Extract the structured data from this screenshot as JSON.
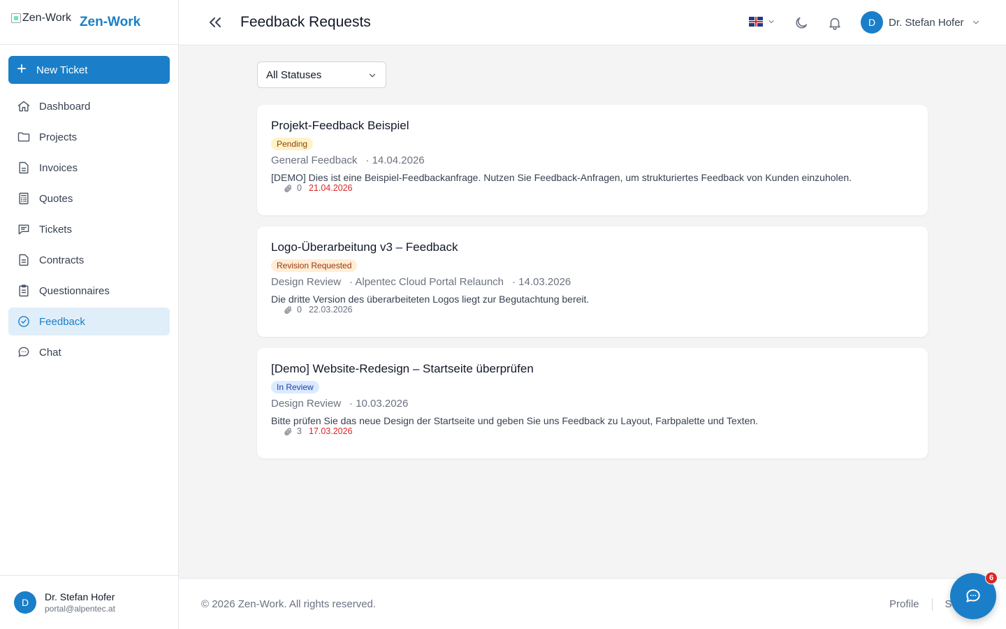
{
  "brand": {
    "logo_alt": "Zen-Work",
    "name": "Zen-Work"
  },
  "sidebar": {
    "new_ticket_label": "New Ticket",
    "items": [
      {
        "label": "Dashboard",
        "icon": "home-icon"
      },
      {
        "label": "Projects",
        "icon": "folder-icon"
      },
      {
        "label": "Invoices",
        "icon": "document-icon"
      },
      {
        "label": "Quotes",
        "icon": "calculator-icon"
      },
      {
        "label": "Tickets",
        "icon": "message-square-icon"
      },
      {
        "label": "Contracts",
        "icon": "document-text-icon"
      },
      {
        "label": "Questionnaires",
        "icon": "clipboard-icon"
      },
      {
        "label": "Feedback",
        "icon": "check-circle-icon",
        "active": true
      },
      {
        "label": "Chat",
        "icon": "chat-bubble-icon"
      }
    ],
    "user": {
      "initial": "D",
      "name": "Dr. Stefan Hofer",
      "email": "portal@alpentec.at"
    }
  },
  "header": {
    "title": "Feedback Requests",
    "language_flag": "uk-flag-icon",
    "user": {
      "initial": "D",
      "name": "Dr. Stefan Hofer"
    }
  },
  "filter": {
    "selected": "All Statuses"
  },
  "cards": [
    {
      "title": "Projekt-Feedback Beispiel",
      "status": "Pending",
      "meta": [
        "General Feedback",
        "· 14.04.2026"
      ],
      "description": "[DEMO] Dies ist eine Beispiel-Feedbackanfrage. Nutzen Sie Feedback-Anfragen, um strukturiertes Feedback von Kunden einzuholen.",
      "attachments": "0",
      "due": "21.04.2026"
    },
    {
      "title": "Logo-Überarbeitung v3 – Feedback",
      "status": "Revision Requested",
      "meta": [
        "Design Review",
        "· Alpentec Cloud Portal Relaunch",
        "· 14.03.2026"
      ],
      "description": "Die dritte Version des überarbeiteten Logos liegt zur Begutachtung bereit.",
      "attachments": "0",
      "due": "22.03.2026"
    },
    {
      "title": "[Demo] Website-Redesign – Startseite überprüfen",
      "status": "In Review",
      "meta": [
        "Design Review",
        "· 10.03.2026"
      ],
      "description": "Bitte prüfen Sie das neue Design der Startseite und geben Sie uns Feedback zu Layout, Farbpalette und Texten.",
      "attachments": "3",
      "due": "17.03.2026"
    }
  ],
  "footer": {
    "copyright": "© 2026 Zen-Work. All rights reserved.",
    "links": [
      "Profile",
      "S"
    ]
  },
  "chat_fab": {
    "badge": "6"
  },
  "colors": {
    "accent": "#1a7fc8",
    "overdue": "#dc2626"
  }
}
